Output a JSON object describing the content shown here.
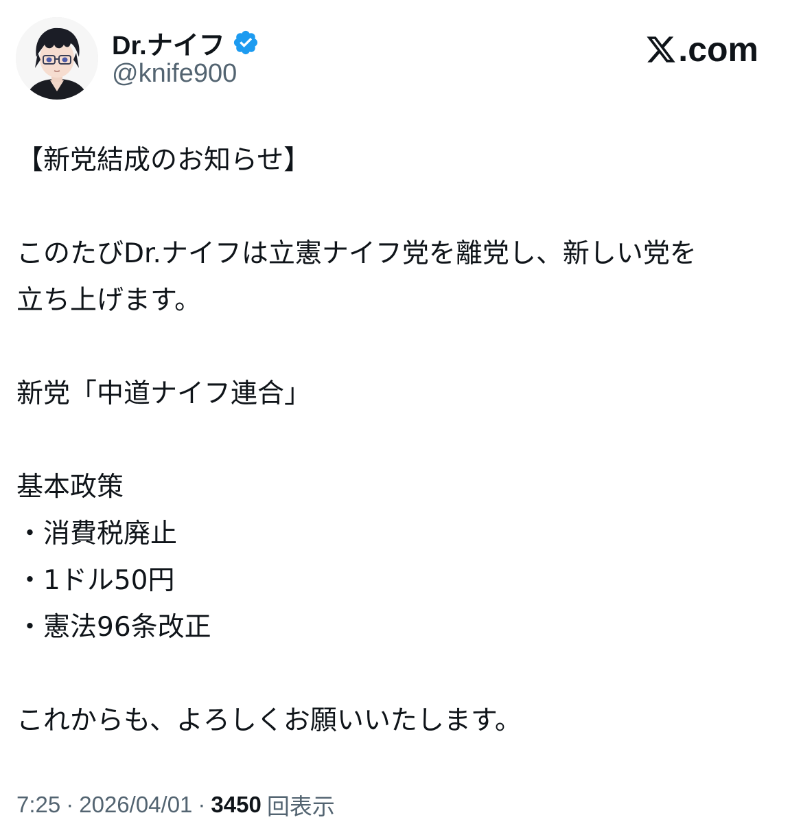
{
  "author": {
    "display_name": "Dr.ナイフ",
    "handle": "@knife900",
    "verified": true,
    "verified_color": "#1d9bf0"
  },
  "brand": {
    "domain_text": ".com",
    "icon": "x-logo-icon"
  },
  "tweet": {
    "lines": [
      "【新党結成のお知らせ】",
      "",
      "このたびDr.ナイフは立憲ナイフ党を離党し、新しい党を",
      "立ち上げます。",
      "",
      "新党「中道ナイフ連合」",
      "",
      "基本政策",
      "・消費税廃止",
      "・1ドル50円",
      "・憲法96条改正",
      "",
      "これからも、よろしくお願いいたします。"
    ]
  },
  "meta": {
    "time": "7:25",
    "separator": "·",
    "date": "2026/04/01",
    "views_count": "3450",
    "views_label": "回表示"
  }
}
